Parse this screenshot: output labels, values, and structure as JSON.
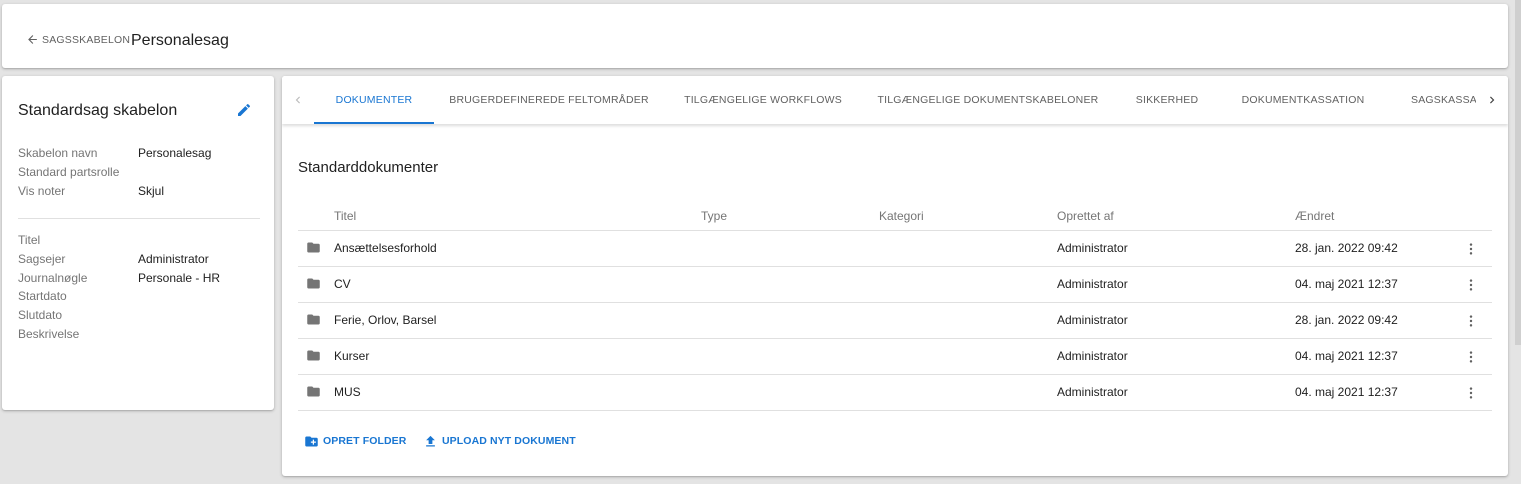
{
  "header": {
    "back_label": "SAGSSKABELON",
    "title": "Personalesag"
  },
  "info_card": {
    "title": "Standardsag skabelon",
    "edit_icon": "pencil-icon",
    "fields_top": [
      {
        "label": "Skabelon navn",
        "value": "Personalesag"
      },
      {
        "label": "Standard partsrolle",
        "value": ""
      },
      {
        "label": "Vis noter",
        "value": "Skjul"
      }
    ],
    "fields_bottom": [
      {
        "label": "Titel",
        "value": ""
      },
      {
        "label": "Sagsejer",
        "value": "Administrator"
      },
      {
        "label": "Journalnøgle",
        "value": "Personale - HR"
      },
      {
        "label": "Startdato",
        "value": ""
      },
      {
        "label": "Slutdato",
        "value": ""
      },
      {
        "label": "Beskrivelse",
        "value": ""
      }
    ]
  },
  "tabs": [
    {
      "label": "DOKUMENTER",
      "active": true
    },
    {
      "label": "BRUGERDEFINEREDE FELTOMRÅDER",
      "active": false
    },
    {
      "label": "TILGÆNGELIGE WORKFLOWS",
      "active": false
    },
    {
      "label": "TILGÆNGELIGE DOKUMENTSKABELONER",
      "active": false
    },
    {
      "label": "SIKKERHED",
      "active": false
    },
    {
      "label": "DOKUMENTKASSATION",
      "active": false
    },
    {
      "label": "SAGSKASSAT",
      "active": false
    }
  ],
  "section": {
    "title": "Standarddokumenter"
  },
  "table": {
    "columns": {
      "title": "Titel",
      "type": "Type",
      "category": "Kategori",
      "created_by": "Oprettet af",
      "changed": "Ændret"
    },
    "rows": [
      {
        "icon": "folder-icon",
        "title": "Ansættelsesforhold",
        "type": "",
        "category": "",
        "created_by": "Administrator",
        "changed": "28. jan. 2022 09:42"
      },
      {
        "icon": "folder-icon",
        "title": "CV",
        "type": "",
        "category": "",
        "created_by": "Administrator",
        "changed": "04. maj 2021 12:37"
      },
      {
        "icon": "folder-icon",
        "title": "Ferie, Orlov, Barsel",
        "type": "",
        "category": "",
        "created_by": "Administrator",
        "changed": "28. jan. 2022 09:42"
      },
      {
        "icon": "folder-icon",
        "title": "Kurser",
        "type": "",
        "category": "",
        "created_by": "Administrator",
        "changed": "04. maj 2021 12:37"
      },
      {
        "icon": "folder-icon",
        "title": "MUS",
        "type": "",
        "category": "",
        "created_by": "Administrator",
        "changed": "04. maj 2021 12:37"
      }
    ]
  },
  "actions": {
    "create_folder": "OPRET FOLDER",
    "upload": "UPLOAD NYT DOKUMENT"
  },
  "colors": {
    "accent": "#1976d2",
    "background": "#e4e4e4",
    "icon_grey": "#757575"
  }
}
